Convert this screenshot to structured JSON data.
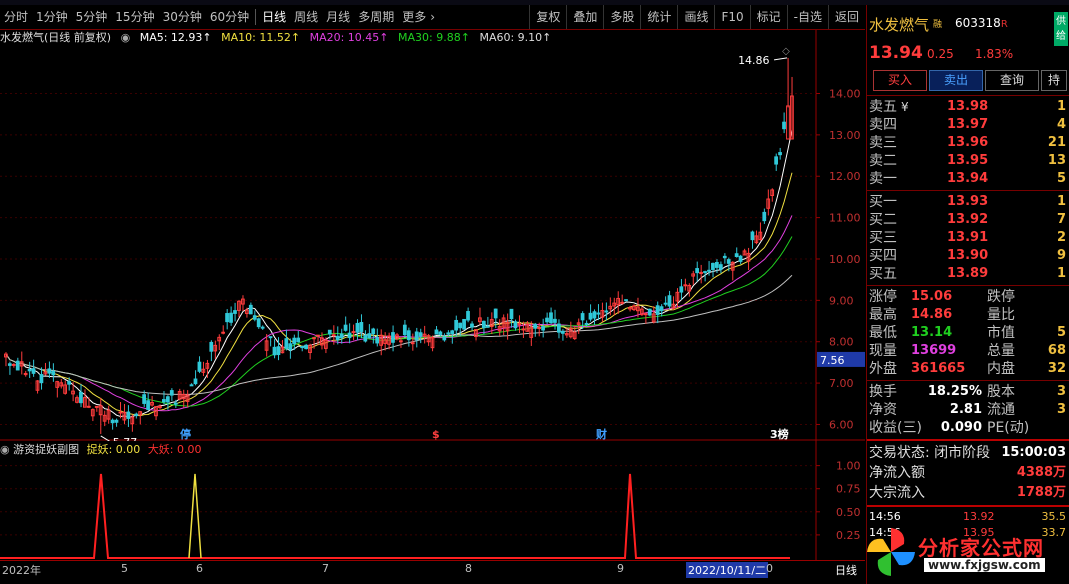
{
  "toolbar": {
    "periods": [
      "分时",
      "1分钟",
      "5分钟",
      "15分钟",
      "30分钟",
      "60分钟",
      "日线",
      "周线",
      "月线",
      "多周期",
      "更多"
    ],
    "active_period": "日线",
    "more_arrow": "›",
    "right_buttons": [
      "复权",
      "叠加",
      "多股",
      "统计",
      "画线",
      "F10",
      "标记",
      "-自选",
      "返回"
    ]
  },
  "legend": {
    "title": "水发燃气(日线 前复权)",
    "ma5": "MA5: 12.93↑",
    "ma10": "MA10: 11.52↑",
    "ma20": "MA20: 10.45↑",
    "ma30": "MA30: 9.88↑",
    "ma60": "MA60: 9.10↑"
  },
  "chart_data": {
    "type": "candlestick",
    "price_axis": [
      "14.00",
      "13.00",
      "12.00",
      "11.00",
      "10.00",
      "9.00",
      "8.00",
      "7.00",
      "6.00"
    ],
    "ylim": [
      5.6,
      15.1
    ],
    "high_label": "14.86",
    "low_label": "5.77",
    "current_marker": "7.56",
    "event_markers": [
      {
        "text": "停",
        "color": "#40a0ff"
      },
      {
        "text": "$",
        "color": "#ff4040"
      },
      {
        "text": "财",
        "color": "#40a0ff"
      },
      {
        "text": "3榜",
        "color": "#ffffff"
      }
    ],
    "colors": {
      "up": "#ff3c3c",
      "down": "#30c8d8",
      "ma5": "#ffffff",
      "ma10": "#f0e040",
      "ma20": "#e040e0",
      "ma30": "#20d020",
      "ma60": "#c0c0c0"
    }
  },
  "sub_chart": {
    "title": "游资捉妖副图",
    "label1": "捉妖: 0.00",
    "label2": "大妖: 0.00",
    "axis": [
      "1.00",
      "0.75",
      "0.50",
      "0.25"
    ]
  },
  "xaxis": {
    "labels": [
      "2022年",
      "5",
      "6",
      "7",
      "8",
      "9"
    ],
    "highlight_date": "2022/10/11/二",
    "tail_label": "0",
    "period": "日线"
  },
  "panel": {
    "name": "水发燃气",
    "code": "603318",
    "code_flag": "R",
    "badge": "供给",
    "small_tag": "融",
    "price": "13.94",
    "change": "0.25",
    "change_pct": "1.83%",
    "buttons": {
      "buy": "买入",
      "sell": "卖出",
      "query": "查询",
      "more": "持"
    },
    "sells": [
      {
        "label": "卖五",
        "tag": "¥",
        "price": "13.98",
        "qty": "1"
      },
      {
        "label": "卖四",
        "price": "13.97",
        "qty": "4"
      },
      {
        "label": "卖三",
        "price": "13.96",
        "qty": "21"
      },
      {
        "label": "卖二",
        "price": "13.95",
        "qty": "13"
      },
      {
        "label": "卖一",
        "price": "13.94",
        "qty": "5"
      }
    ],
    "buys": [
      {
        "label": "买一",
        "price": "13.93",
        "qty": "1"
      },
      {
        "label": "买二",
        "price": "13.92",
        "qty": "7"
      },
      {
        "label": "买三",
        "price": "13.91",
        "qty": "2"
      },
      {
        "label": "买四",
        "price": "13.90",
        "qty": "9"
      },
      {
        "label": "买五",
        "price": "13.89",
        "qty": "1"
      }
    ],
    "stats": [
      {
        "l1": "涨停",
        "v1": "15.06",
        "c1": "red",
        "l2": "跌停",
        "v2": ""
      },
      {
        "l1": "最高",
        "v1": "14.86",
        "c1": "red",
        "l2": "量比",
        "v2": ""
      },
      {
        "l1": "最低",
        "v1": "13.14",
        "c1": "green",
        "l2": "市值",
        "v2": "5"
      },
      {
        "l1": "现量",
        "v1": "13699",
        "c1": "mag",
        "l2": "总量",
        "v2": "68"
      },
      {
        "l1": "外盘",
        "v1": "361665",
        "c1": "red",
        "l2": "内盘",
        "v2": "32"
      }
    ],
    "stats2": [
      {
        "l1": "换手",
        "v1": "18.25%",
        "l2": "股本",
        "v2": "3"
      },
      {
        "l1": "净资",
        "v1": "2.81",
        "l2": "流通",
        "v2": "3"
      },
      {
        "l1": "收益(三)",
        "v1": "0.090",
        "l2": "PE(动)",
        "v2": ""
      }
    ],
    "trade_status": "交易状态: 闭市阶段",
    "trade_time": "15:00:03",
    "net_flow_label": "净流入额",
    "net_flow": "4388万",
    "block_flow_label": "大宗流入",
    "block_flow": "1788万",
    "ticks": [
      {
        "t": "14:56",
        "p": "13.92",
        "v": "35.5"
      },
      {
        "t": "14:56",
        "p": "13.95",
        "v": "33.7"
      }
    ]
  },
  "watermark": {
    "text": "分析家公式网",
    "url": "www.fxjgsw.com"
  }
}
